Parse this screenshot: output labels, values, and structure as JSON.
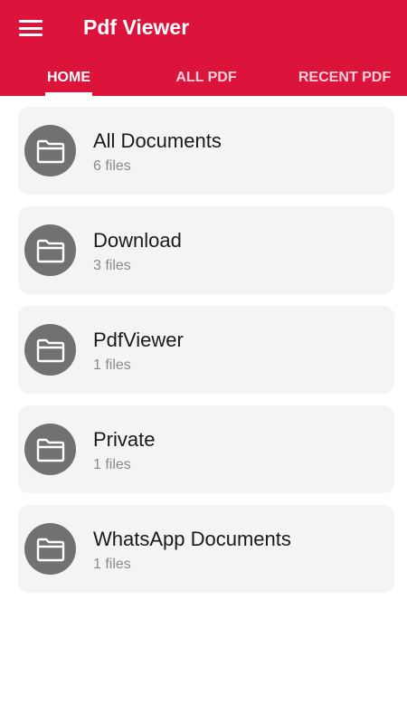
{
  "appbar": {
    "title": "Pdf Viewer",
    "menu_icon": "hamburger-menu-icon",
    "color": "#dc143c"
  },
  "tabs": [
    {
      "label": "HOME",
      "active": true
    },
    {
      "label": "ALL PDF",
      "active": false
    },
    {
      "label": "RECENT PDF",
      "active": false
    }
  ],
  "folders": [
    {
      "name": "All Documents",
      "count": "6 files",
      "icon": "folder-icon"
    },
    {
      "name": "Download",
      "count": "3 files",
      "icon": "folder-icon"
    },
    {
      "name": "PdfViewer",
      "count": "1 files",
      "icon": "folder-icon"
    },
    {
      "name": "Private",
      "count": "1 files",
      "icon": "folder-icon"
    },
    {
      "name": "WhatsApp Documents",
      "count": "1 files",
      "icon": "folder-icon"
    }
  ]
}
